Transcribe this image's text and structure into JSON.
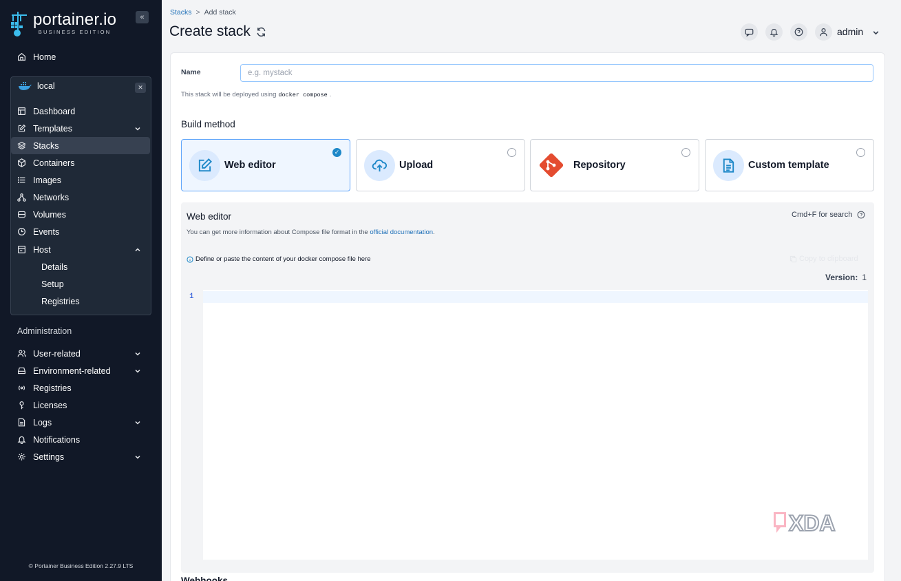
{
  "brand": {
    "name": "portainer.io",
    "edition": "BUSINESS EDITION"
  },
  "sidebar": {
    "home": "Home",
    "environment": {
      "name": "local"
    },
    "env_items": [
      {
        "label": "Dashboard",
        "icon": "dashboard-icon"
      },
      {
        "label": "Templates",
        "icon": "edit-icon",
        "expandable": true
      },
      {
        "label": "Stacks",
        "icon": "layers-icon",
        "active": true
      },
      {
        "label": "Containers",
        "icon": "box-icon"
      },
      {
        "label": "Images",
        "icon": "list-icon"
      },
      {
        "label": "Networks",
        "icon": "network-icon"
      },
      {
        "label": "Volumes",
        "icon": "database-icon"
      },
      {
        "label": "Events",
        "icon": "clock-icon"
      },
      {
        "label": "Host",
        "icon": "server-icon",
        "expanded": true
      }
    ],
    "host_sub_items": [
      "Details",
      "Setup",
      "Registries"
    ],
    "admin_title": "Administration",
    "admin_items": [
      {
        "label": "User-related",
        "icon": "users-icon",
        "expandable": true
      },
      {
        "label": "Environment-related",
        "icon": "hdd-icon",
        "expandable": true
      },
      {
        "label": "Registries",
        "icon": "radio-icon"
      },
      {
        "label": "Licenses",
        "icon": "key-icon"
      },
      {
        "label": "Logs",
        "icon": "file-icon",
        "expandable": true
      },
      {
        "label": "Notifications",
        "icon": "bell-icon"
      },
      {
        "label": "Settings",
        "icon": "gear-icon",
        "expandable": true
      }
    ],
    "footer": "© Portainer Business Edition  2.27.9 LTS"
  },
  "header": {
    "breadcrumb": {
      "parent": "Stacks",
      "separator": ">",
      "current": "Add stack"
    },
    "title": "Create stack",
    "user": "admin"
  },
  "form": {
    "name_label": "Name",
    "name_placeholder": "e.g. mystack",
    "deploy_prefix": "This stack will be deployed using",
    "deploy_tool": "docker compose",
    "deploy_suffix": ".",
    "build_method_title": "Build method",
    "methods": [
      {
        "label": "Web editor",
        "icon": "edit-icon",
        "selected": true
      },
      {
        "label": "Upload",
        "icon": "upload-cloud-icon",
        "selected": false
      },
      {
        "label": "Repository",
        "icon": "git-icon",
        "selected": false
      },
      {
        "label": "Custom template",
        "icon": "file-text-icon",
        "selected": false
      }
    ]
  },
  "editor": {
    "title": "Web editor",
    "search_hint": "Cmd+F for search",
    "info_prefix": "You can get more information about Compose file format in the",
    "info_link": "official documentation",
    "info_suffix": ".",
    "hint": "Define or paste the content of your docker compose file here",
    "copy_label": "Copy to clipboard",
    "version_label": "Version:",
    "version_value": "1",
    "line_number": "1"
  },
  "next_section": "Webhooks",
  "colors": {
    "sidebar_bg": "#111827",
    "accent": "#1e88c8",
    "link": "#1d6fb8"
  }
}
